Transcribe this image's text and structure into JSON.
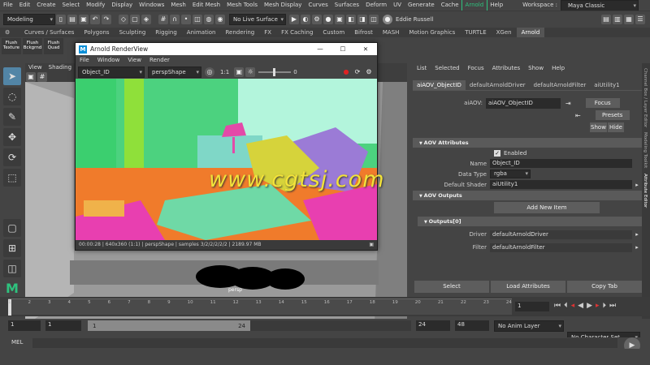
{
  "menubar": {
    "items": [
      "File",
      "Edit",
      "Create",
      "Select",
      "Modify",
      "Display",
      "Windows",
      "Mesh",
      "Edit Mesh",
      "Mesh Tools",
      "Mesh Display",
      "Curves",
      "Surfaces",
      "Deform",
      "UV",
      "Generate",
      "Cache",
      "Arnold",
      "Help"
    ],
    "workspace_label": "Workspace :",
    "workspace_value": "Maya Classic"
  },
  "statusline": {
    "mode": "Modeling",
    "live_surface": "No Live Surface",
    "user": "Eddie Russell"
  },
  "shelf": {
    "tabs": [
      "Curves / Surfaces",
      "Polygons",
      "Sculpting",
      "Rigging",
      "Animation",
      "Rendering",
      "FX",
      "FX Caching",
      "Custom",
      "Bifrost",
      "MASH",
      "Motion Graphics",
      "TURTLE",
      "XGen",
      "Arnold"
    ],
    "buttons": [
      "Flush Texture",
      "Flush Bckgrnd",
      "Flush Quad"
    ]
  },
  "viewport": {
    "menu": [
      "View",
      "Shading"
    ],
    "camera_label": "persp"
  },
  "renderview": {
    "title": "Arnold RenderView",
    "menu": [
      "File",
      "Window",
      "View",
      "Render"
    ],
    "aov": "Object_ID",
    "camera": "perspShape",
    "ratio": "1:1",
    "exposure": "0",
    "status": "00:00:28 | 640x360 (1:1) | perspShape | samples 3/2/2/2/2/2 | 2189.97 MB",
    "watermark": "www.cgtsj.com"
  },
  "attr": {
    "menu": [
      "List",
      "Selected",
      "Focus",
      "Attributes",
      "Show",
      "Help"
    ],
    "tabs": [
      "aiAOV_ObjectID",
      "defaultArnoldDriver",
      "defaultArnoldFilter",
      "aiUtility1"
    ],
    "aov_label": "aiAOV:",
    "aov_value": "aiAOV_ObjectID",
    "focus": "Focus",
    "presets": "Presets",
    "show": "Show",
    "hide": "Hide",
    "sec_aov": "AOV Attributes",
    "enabled": "Enabled",
    "name_label": "Name",
    "name_value": "Object_ID",
    "type_label": "Data Type",
    "type_value": "rgba",
    "shader_label": "Default Shader",
    "shader_value": "aiUtility1",
    "sec_outputs": "AOV Outputs",
    "add_item": "Add New Item",
    "outputs0": "Outputs[0]",
    "driver_label": "Driver",
    "driver_value": "defaultArnoldDriver",
    "filter_label": "Filter",
    "filter_value": "defaultArnoldFilter",
    "select": "Select",
    "load": "Load Attributes",
    "copy": "Copy Tab"
  },
  "sidetabs": [
    "Channel Box / Layer Editor",
    "Modeling Toolkit",
    "Attribute Editor"
  ],
  "timeline": {
    "ticks": [
      "1",
      "2",
      "3",
      "4",
      "5",
      "6",
      "7",
      "8",
      "9",
      "10",
      "11",
      "12",
      "13",
      "14",
      "15",
      "16",
      "17",
      "18",
      "19",
      "20",
      "21",
      "22",
      "23",
      "24"
    ],
    "current": "1"
  },
  "range": {
    "start": "1",
    "start2": "1",
    "range_start": "1",
    "range_end": "24",
    "end": "24",
    "end2": "48",
    "anim_layer": "No Anim Layer",
    "char_set": "No Character Set"
  },
  "mel": "MEL"
}
